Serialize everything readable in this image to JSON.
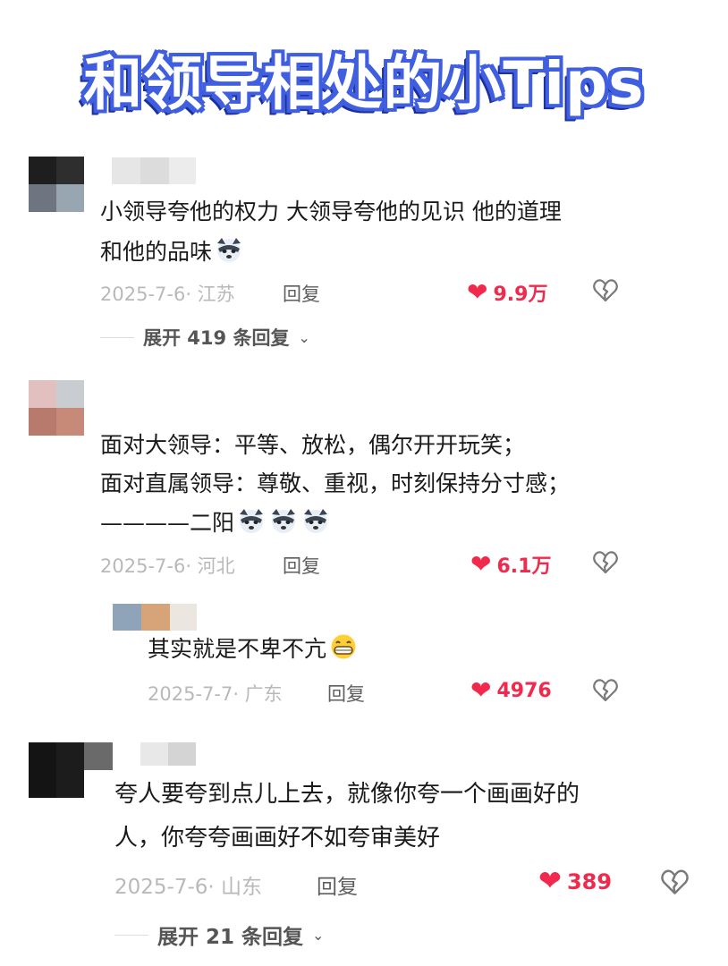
{
  "title": "和领导相处的小Tips",
  "comments": [
    {
      "text_lines": [
        "小领导夸他的权力 大领导夸他的见识 他的道理",
        "和他的品味"
      ],
      "emoji_after": "husky-emoji",
      "emoji_count": 1,
      "date_location": "2025-7-6· 江苏",
      "reply_label": "回复",
      "likes": "9.9万",
      "expand_label": "展开 419 条回复",
      "avatar_colors": [
        "#1e1e1e",
        "#2e2e2e",
        "#6e7480",
        "#98a6b2"
      ],
      "name_colors": [
        "#e6e6e6",
        "#dcdcdc",
        "#ececec"
      ]
    },
    {
      "text_lines": [
        "面对大领导：平等、放松，偶尔开开玩笑；",
        "面对直属领导：尊敬、重视，时刻保持分寸感；",
        "————二阳"
      ],
      "emoji_after": "husky-emoji",
      "emoji_count": 3,
      "date_location": "2025-7-6· 河北",
      "reply_label": "回复",
      "likes": "6.1万",
      "avatar_colors": [
        "#e3c0c0",
        "#c9cdd2",
        "#b87a6c",
        "#c88a78"
      ],
      "replies": [
        {
          "text": "其实就是不卑不亢",
          "emoji_after": "grin-emoji",
          "date_location": "2025-7-7· 广东",
          "reply_label": "回复",
          "likes": "4976",
          "name_colors": [
            "#8fa4b8",
            "#d7a47a",
            "#ebe6df"
          ]
        }
      ]
    },
    {
      "text_lines": [
        "夸人要夸到点儿上去，就像你夸一个画画好的",
        "人，你夸夸画画好不如夸审美好"
      ],
      "date_location": "2025-7-6· 山东",
      "reply_label": "回复",
      "likes": "389",
      "expand_label": "展开 21 条回复",
      "avatar_colors": [
        "#141414",
        "#1c1c1c",
        "#6a6a6a"
      ],
      "name_colors": [
        "#e8e8e8",
        "#d4d4d4"
      ]
    }
  ],
  "colors": {
    "like": "#f0294d",
    "meta": "#b9b9b9",
    "title_outline": "#3f5ee0"
  }
}
